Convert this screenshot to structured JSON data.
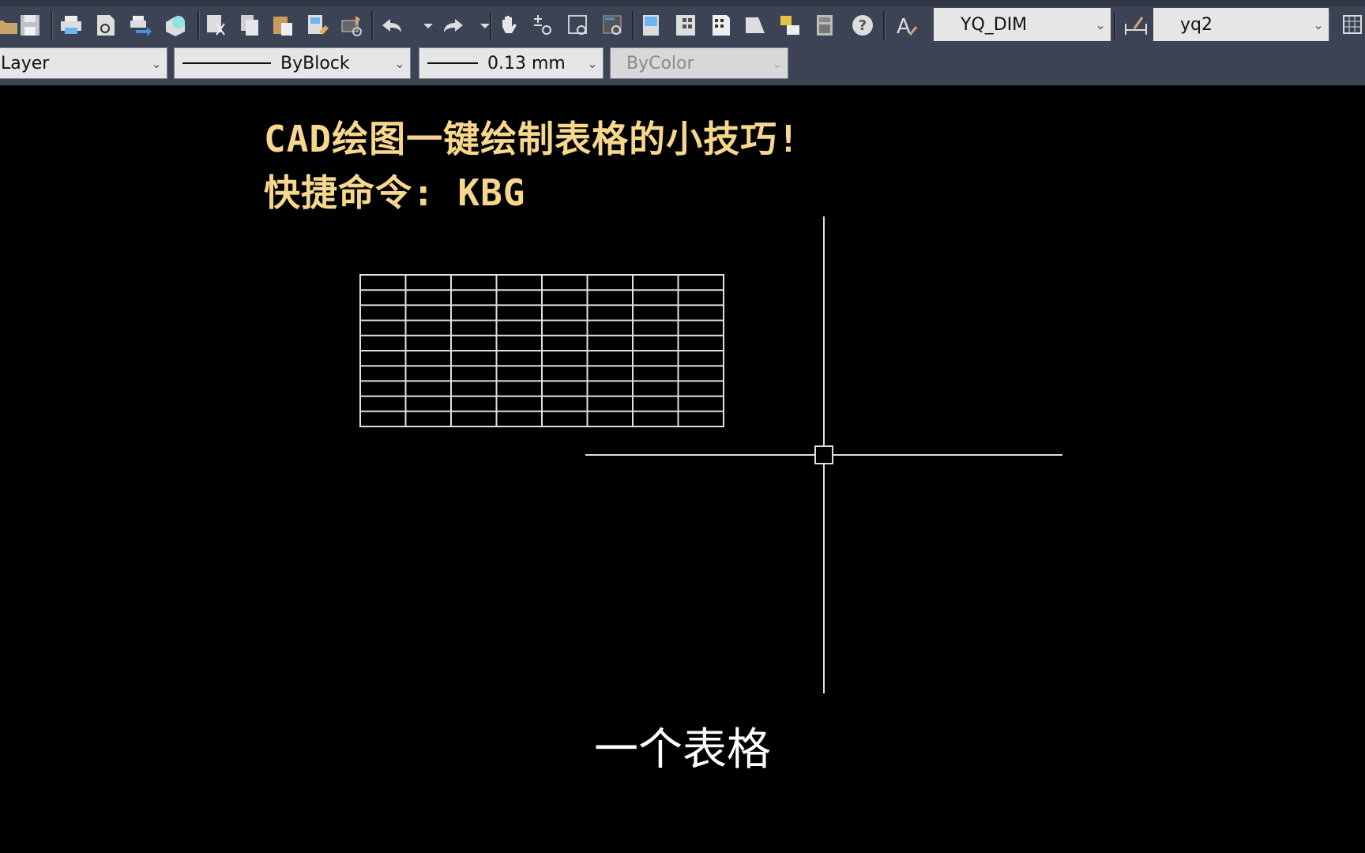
{
  "toolbar": {
    "icons": [
      {
        "name": "open-icon"
      },
      {
        "name": "save-icon"
      },
      {
        "name": "plot-icon"
      },
      {
        "name": "plot-preview-icon"
      },
      {
        "name": "publish-icon"
      },
      {
        "name": "3d-print-icon"
      },
      {
        "name": "cut-icon"
      },
      {
        "name": "copy-icon"
      },
      {
        "name": "paste-icon"
      },
      {
        "name": "match-properties-icon"
      },
      {
        "name": "block-editor-icon"
      },
      {
        "name": "undo-icon"
      },
      {
        "name": "undo-dropdown-icon"
      },
      {
        "name": "redo-icon"
      },
      {
        "name": "redo-dropdown-icon"
      },
      {
        "name": "pan-icon"
      },
      {
        "name": "zoom-realtime-icon"
      },
      {
        "name": "zoom-window-icon"
      },
      {
        "name": "zoom-previous-icon"
      },
      {
        "name": "properties-icon"
      },
      {
        "name": "design-center-icon"
      },
      {
        "name": "tool-palettes-icon"
      },
      {
        "name": "sheet-set-icon"
      },
      {
        "name": "markup-icon"
      },
      {
        "name": "calculator-icon"
      },
      {
        "name": "help-icon"
      },
      {
        "name": "text-style-icon"
      },
      {
        "name": "dim-style-icon"
      },
      {
        "name": "table-style-icon"
      }
    ],
    "text_style": "YQ_DIM",
    "dim_style": "yq2",
    "layer_color": "Layer",
    "linetype": "ByBlock",
    "lineweight": "0.13 mm",
    "plot_style": "ByColor"
  },
  "canvas": {
    "title_line1": "CAD绘图一键绘制表格的小技巧!",
    "title_line2": "快捷命令: KBG",
    "subtitle": "一个表格",
    "table": {
      "columns": 8,
      "rows": 10
    },
    "colors": {
      "title": "#f7d78c",
      "background": "#000000",
      "lines": "#e0e0e0"
    }
  }
}
